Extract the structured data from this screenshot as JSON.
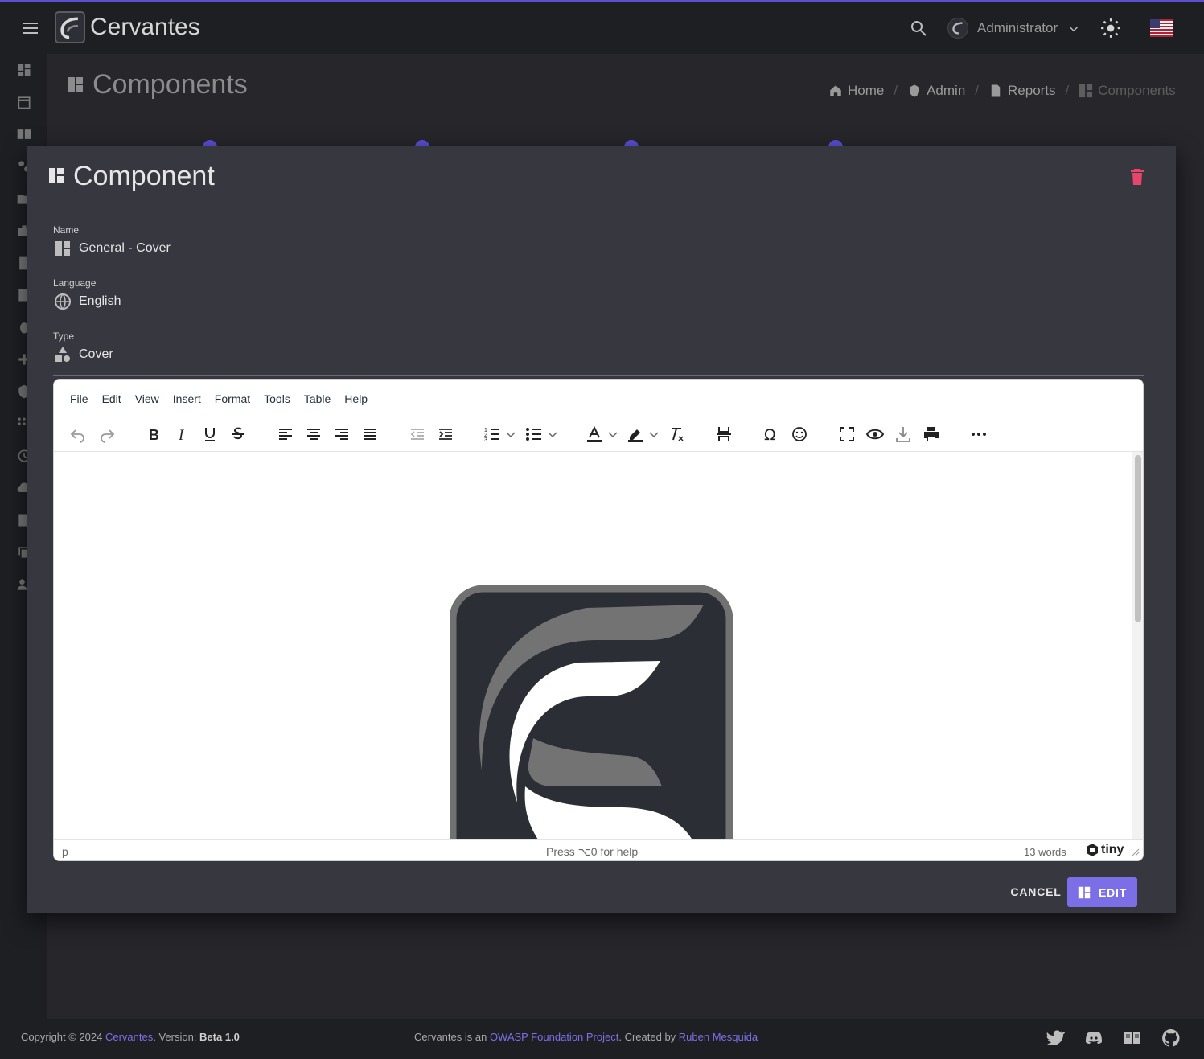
{
  "app": {
    "brand": "Cervantes",
    "user": "Administrator"
  },
  "page": {
    "title": "Components",
    "breadcrumbs": [
      {
        "label": "Home"
      },
      {
        "label": "Admin"
      },
      {
        "label": "Reports"
      },
      {
        "label": "Components"
      }
    ]
  },
  "dialog": {
    "title": "Component",
    "fields": {
      "name": {
        "label": "Name",
        "value": "General - Cover"
      },
      "language": {
        "label": "Language",
        "value": "English"
      },
      "type": {
        "label": "Type",
        "value": "Cover"
      }
    },
    "editor": {
      "menu": [
        "File",
        "Edit",
        "View",
        "Insert",
        "Format",
        "Tools",
        "Table",
        "Help"
      ],
      "status_path": "p",
      "help_text": "Press ⌥0 for help",
      "word_count": "13 words",
      "brand": "tiny"
    },
    "cancel_label": "CANCEL",
    "edit_label": "EDIT"
  },
  "footer": {
    "copyright_prefix": "Copyright © 2024 ",
    "copyright_link": "Cervantes",
    "version_prefix": ". Version: ",
    "version": "Beta 1.0",
    "mid_prefix": "Cervantes is an ",
    "owasp_link": "OWASP Foundation Project",
    "created_by": ". Created by ",
    "author_link": "Ruben Mesquida"
  },
  "colors": {
    "accent": "#7b6ee6",
    "danger": "#e8456b",
    "surface": "#36373f",
    "background": "#26262b"
  }
}
